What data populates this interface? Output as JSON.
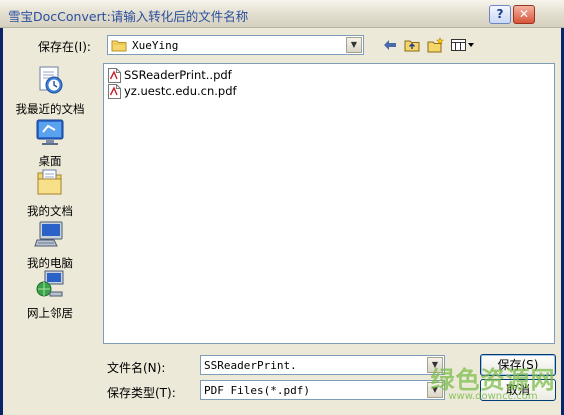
{
  "window": {
    "title": "雪宝DocConvert:请输入转化后的文件名称",
    "help_label": "?",
    "close_label": "✕"
  },
  "toolbar": {
    "save_in_label": "保存在(I):",
    "current_folder": "XueYing",
    "back_icon": "back-arrow-icon",
    "up_icon": "up-folder-icon",
    "new_folder_icon": "new-folder-icon",
    "views_icon": "views-menu-icon"
  },
  "places": [
    {
      "label": "我最近的文档",
      "icon": "recent-documents-icon"
    },
    {
      "label": "桌面",
      "icon": "desktop-icon"
    },
    {
      "label": "我的文档",
      "icon": "my-documents-icon"
    },
    {
      "label": "我的电脑",
      "icon": "my-computer-icon"
    },
    {
      "label": "网上邻居",
      "icon": "network-places-icon"
    }
  ],
  "files": [
    {
      "name": "SSReaderPrint..pdf",
      "icon": "pdf-file-icon"
    },
    {
      "name": "yz.uestc.edu.cn.pdf",
      "icon": "pdf-file-icon"
    }
  ],
  "form": {
    "filename_label": "文件名(N):",
    "filename_value": "SSReaderPrint.",
    "filetype_label": "保存类型(T):",
    "filetype_value": "PDF Files(*.pdf)"
  },
  "buttons": {
    "save_label": "保存(S)",
    "cancel_label": "取消"
  },
  "watermark": {
    "logo_text": "绿色资源网",
    "url": "www.downcc.com"
  }
}
